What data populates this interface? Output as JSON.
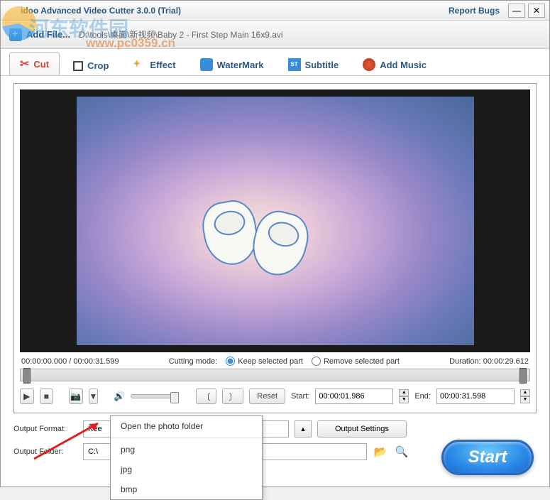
{
  "titlebar": {
    "title": "idoo Advanced Video Cutter 3.0.0 (Trial)",
    "report_bugs": "Report Bugs"
  },
  "toolbar": {
    "add_file": "Add File...",
    "file_path": "D:\\tools\\桌面\\新视频\\Baby 2 - First Step Main 16x9.avi"
  },
  "watermark": {
    "site": "河东软件园",
    "domain": "www.pc0359.cn"
  },
  "tabs": {
    "cut": "Cut",
    "crop": "Crop",
    "effect": "Effect",
    "watermark": "WaterMark",
    "subtitle": "Subtitle",
    "add_music": "Add Music"
  },
  "video": {
    "position": "00:00:00.000",
    "total": "00:00:31.599",
    "cutting_mode_label": "Cutting mode:",
    "keep_selected": "Keep selected part",
    "remove_selected": "Remove selected part",
    "duration_label": "Duration:",
    "duration": "00:00:29.612"
  },
  "controls": {
    "reset": "Reset",
    "start_label": "Start:",
    "start_time": "00:00:01.986",
    "end_label": "End:",
    "end_time": "00:00:31.598"
  },
  "snapshot_menu": {
    "open_folder": "Open the photo folder",
    "png": "png",
    "jpg": "jpg",
    "bmp": "bmp"
  },
  "output": {
    "format_label": "Output Format:",
    "format_value": "Kee",
    "settings": "Output Settings",
    "folder_label": "Output Folder:",
    "folder_value": "C:\\"
  },
  "start_button": "Start"
}
